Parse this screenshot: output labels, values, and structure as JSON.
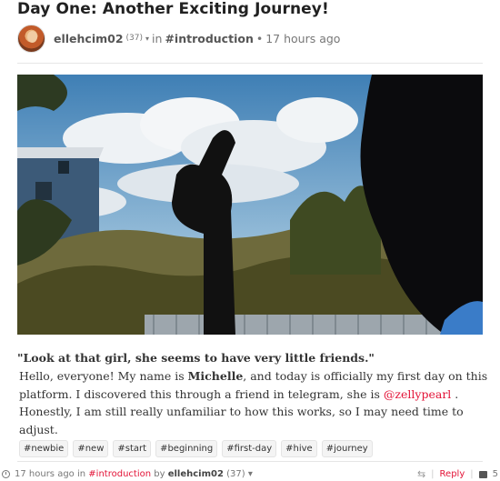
{
  "post": {
    "title": "Day One: Another Exciting Journey!",
    "author": "ellehcim02",
    "reputation": "(37)",
    "in_label": "in",
    "category": "#introduction",
    "dot": "•",
    "time_ago": "17 hours ago"
  },
  "body": {
    "quote": "\"Look at that girl, she seems to have very little friends.\"",
    "p1": "Hello, everyone! My name is ",
    "name_bold": "Michelle",
    "p2": ", and today is officially my first day on this platform. I discovered this through a friend in telegram, she is ",
    "mention": "@zellypearl",
    "p3": " . Honestly, I am still really unfamiliar to how this works, so I may need time to adjust."
  },
  "tags": [
    "#newbie",
    "#new",
    "#start",
    "#beginning",
    "#first-day",
    "#hive",
    "#journey"
  ],
  "footer": {
    "time_ago": "17 hours ago",
    "in_label": "in",
    "category": "#introduction",
    "by_label": "by",
    "author": "ellehcim02",
    "reputation": "(37)",
    "reply_label": "Reply",
    "comment_count": "5"
  },
  "colors": {
    "accent": "#e31337"
  },
  "icons": {
    "avatar": "avatar",
    "caret": "chevron-down-icon",
    "clock": "clock-icon",
    "resteem": "resteem-icon",
    "comments": "comments-icon"
  }
}
